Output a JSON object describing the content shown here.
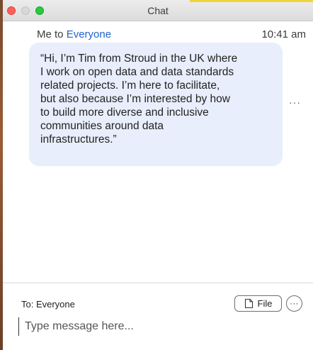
{
  "window": {
    "title": "Chat"
  },
  "message": {
    "sender": "Me to ",
    "recipient": "Everyone",
    "time": "10:41 am",
    "lines": [
      "“Hi, I’m Tim from Stroud in the UK where",
      "I work on open data and data standards",
      "related projects. I’m here to facilitate,",
      "but also because I’m interested by how",
      "to build more diverse and inclusive",
      "communities around data",
      "infrastructures.”"
    ],
    "more_icon": "ellipsis-icon",
    "more_label": "···"
  },
  "composer": {
    "to_label": "To: Everyone",
    "file_label": "File",
    "file_icon": "document-icon",
    "more_icon": "ellipsis-icon",
    "more_label": "···",
    "placeholder": "Type message here...",
    "value": ""
  },
  "colors": {
    "bubble": "#e8eefb",
    "recipient": "#2063c9",
    "close": "#fe5f57",
    "maximize": "#28c840"
  }
}
